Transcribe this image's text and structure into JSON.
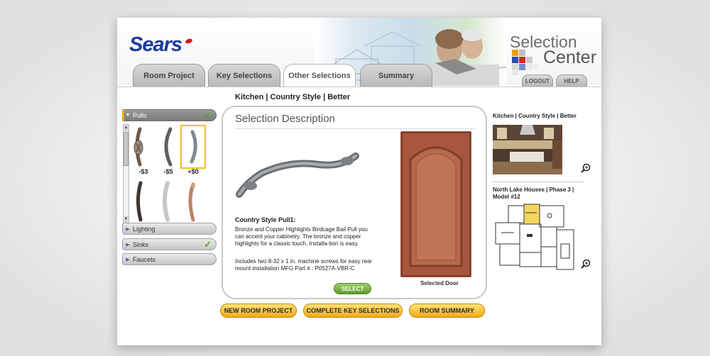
{
  "header": {
    "brand": "Sears",
    "title_line1": "Selection",
    "title_line2": "Center",
    "tabs": [
      {
        "label": "Room Project",
        "active": false
      },
      {
        "label": "Key Selections",
        "active": false
      },
      {
        "label": "Other Selections",
        "active": true
      },
      {
        "label": "Summary",
        "active": false
      }
    ],
    "logout_label": "LOGOUT",
    "help_label": "HELP"
  },
  "breadcrumb": "Kitchen | Country Style | Better",
  "categories": [
    {
      "label": "Pulls",
      "active": true,
      "checked": true
    },
    {
      "label": "Lighting",
      "active": false,
      "checked": false
    },
    {
      "label": "Sinks",
      "active": false,
      "checked": true
    },
    {
      "label": "Faucets",
      "active": false,
      "checked": false
    }
  ],
  "thumbnails": [
    {
      "name": "birdcage-bail-pull",
      "price": "-$3",
      "selected": false
    },
    {
      "name": "dark-bar-pull",
      "price": "-$5",
      "selected": false
    },
    {
      "name": "pewter-arch-pull",
      "price": "+$0",
      "selected": true
    },
    {
      "name": "oil-bronze-pull",
      "price": "",
      "selected": false
    },
    {
      "name": "satin-nickel-pull",
      "price": "",
      "selected": false
    },
    {
      "name": "copper-pull",
      "price": "",
      "selected": false
    }
  ],
  "description": {
    "heading": "Selection Description",
    "product_name": "Country Style Pull1:",
    "text": "Bronze and Copper Highlights Birdcage Bail Pull you can accent your cabinetry. The bronze and copper highlights for a classic touch. Installa-tion is easy.",
    "includes": "Includes two 8-32 x 1 in. machine screws for easy rear mount installation MFG Part # : P0527A-VBR-C",
    "door_caption": "Selected Door",
    "select_label": "SELECT"
  },
  "actions": {
    "new_room": "NEW ROOM PROJECT",
    "complete_key": "COMPLETE KEY SELECTIONS",
    "room_summary": "ROOM SUMMARY"
  },
  "sidebar_right": {
    "room_label": "Kitchen |  Country Style |  Better",
    "plan_label": "North Lake Houses | Phase 3 | Model #12"
  },
  "colors": {
    "brand_blue": "#1a3b9a",
    "accent_yellow": "#f1ab13",
    "check_green": "#5aa02c",
    "select_green": "#6aa83a"
  }
}
